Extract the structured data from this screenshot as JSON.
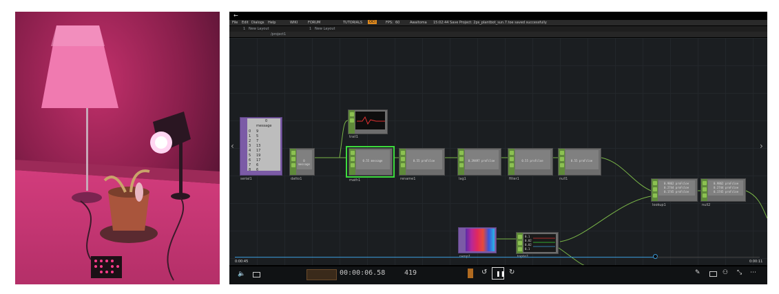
{
  "menu": {
    "back_arrow": "←",
    "items": [
      "File",
      "Edit",
      "Dialogs",
      "Help"
    ],
    "tabs": [
      "WIKI",
      "FORUM",
      "TUTORIALS"
    ],
    "badge": "OCI",
    "fps_label": "FPS:",
    "fps_value": "60",
    "status_user": "Awaitoma",
    "status_message": "15:02:44 Save Project: 2ps_plantbot_sun.7.toe saved successfully"
  },
  "layout_bar": {
    "pane_num": "1",
    "pane_name": "New Layout",
    "layout_num": "1",
    "layout_name": "New Layout"
  },
  "path": "/project1",
  "nodes": {
    "serial": {
      "name": "serial1",
      "header": "0",
      "col_label": "message",
      "rows": [
        "0",
        "1",
        "2",
        "3",
        "4",
        "5",
        "6",
        "7",
        "8",
        "9"
      ],
      "values": [
        "9",
        "5",
        "7",
        "13",
        "17",
        "19",
        "17",
        "6",
        "6",
        ""
      ]
    },
    "datto": {
      "name": "datto1",
      "value": "0 message"
    },
    "math": {
      "name": "math1",
      "value": "0.55 message"
    },
    "rename": {
      "name": "rename1",
      "value": "0.55 proFcloe"
    },
    "lag": {
      "name": "lag1",
      "value": "0.39497 proFcloe"
    },
    "filter": {
      "name": "filter1",
      "value": "0.55 proFcloe"
    },
    "null": {
      "name": "null1",
      "value": "0.55 proFcloe"
    },
    "trail": {
      "name": "trail1"
    },
    "lookup": {
      "name": "lookup1",
      "values": [
        "0.9862 proFcloe",
        "0.2744 proFcloe",
        "0.1745 proFcloe"
      ]
    },
    "null2": {
      "name": "null2",
      "values": [
        "0.9862 proFcloe",
        "0.2744 proFcloe",
        "0.1745 proFcloe"
      ]
    },
    "ramp": {
      "name": "ramp1"
    },
    "topto": {
      "name": "topto1",
      "values": [
        "0.1",
        "0.02",
        "0.02",
        "0.1"
      ]
    }
  },
  "timeline": {
    "start": "0:00:45",
    "end": "0:00:11"
  },
  "transport": {
    "timecode": "00:00:06.58",
    "frame": "419"
  },
  "colors": {
    "node_green": "#8cc152",
    "selected_outline": "#3ddc3d",
    "ramp_purple": "#7b5ba6",
    "wire": "#7ab648",
    "timeline_blue": "#3a9ad9"
  },
  "icons": [
    "arrow-left-icon",
    "chevron-left-icon",
    "chevron-right-icon",
    "mute-icon",
    "monitor-icon",
    "rewind-icon",
    "pause-icon",
    "forward-icon",
    "pencil-icon",
    "screen-icon",
    "people-icon",
    "expand-icon",
    "more-icon"
  ]
}
